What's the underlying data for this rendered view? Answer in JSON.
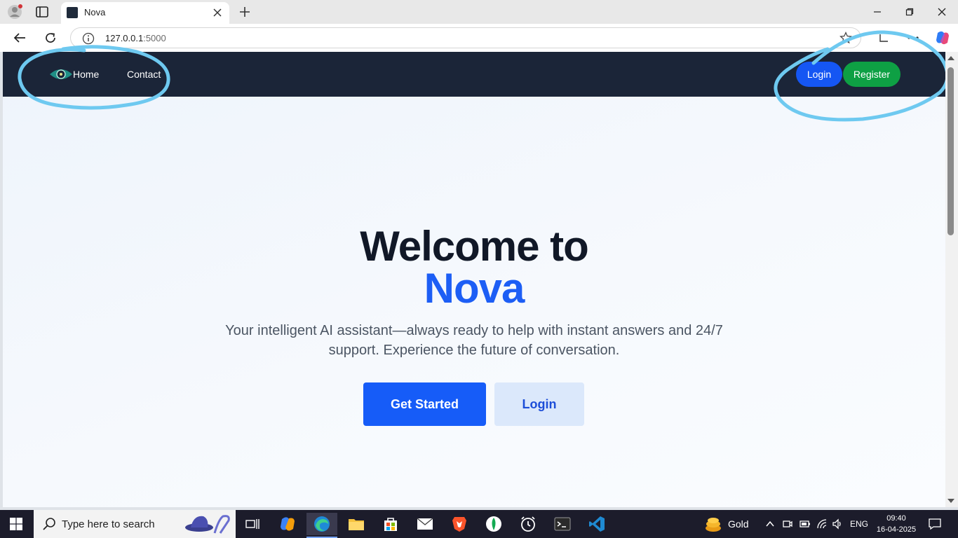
{
  "browser": {
    "tab_title": "Nova",
    "url_host": "127.0.0.1",
    "url_port": ":5000"
  },
  "navbar": {
    "links": [
      {
        "label": "Home"
      },
      {
        "label": "Contact"
      }
    ],
    "login_label": "Login",
    "register_label": "Register"
  },
  "hero": {
    "title_line1": "Welcome to",
    "title_line2": "Nova",
    "subtitle": "Your intelligent AI assistant—always ready to help with instant answers and 24/7 support. Experience the future of conversation.",
    "primary_cta": "Get Started",
    "secondary_cta": "Login"
  },
  "taskbar": {
    "search_placeholder": "Type here to search",
    "weather_label": "Gold",
    "language": "ENG",
    "time": "09:40",
    "date": "16-04-2025"
  },
  "colors": {
    "navbar_bg": "#1b2538",
    "accent_blue": "#1d5ef5",
    "login_pill": "#1556f3",
    "register_pill": "#0ea044",
    "annotation": "#6ec9f0"
  }
}
